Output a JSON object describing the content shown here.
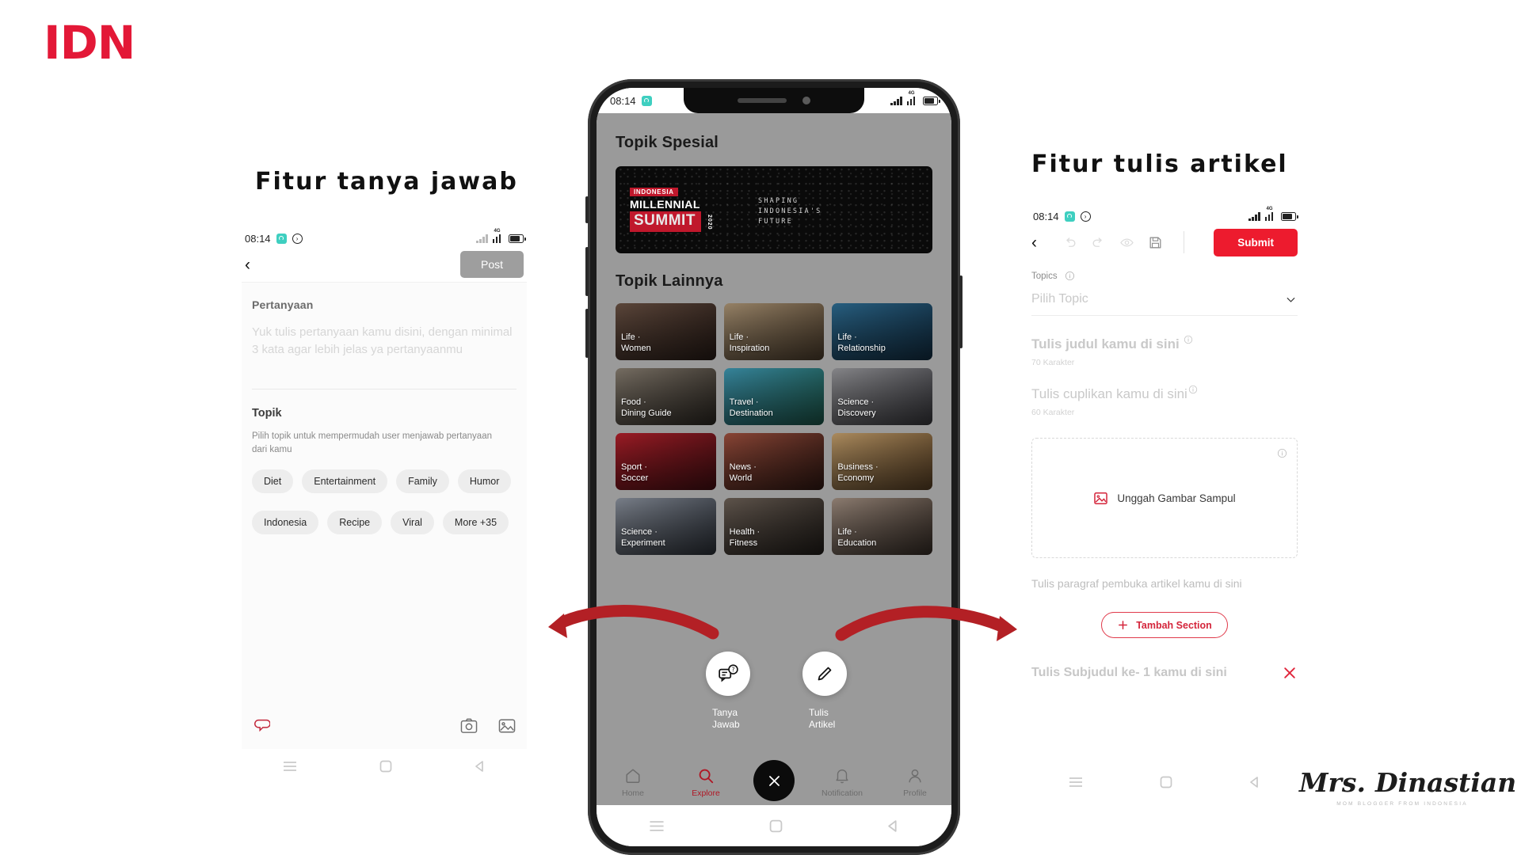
{
  "brand": {
    "logo_text": "IDN",
    "logo_color": "#e31837"
  },
  "headings": {
    "left": "Fitur tanya jawab",
    "right": "Fitur tulis artikel"
  },
  "status_bar": {
    "time": "08:14",
    "network": "4G"
  },
  "left_panel": {
    "back_icon": "‹",
    "post_label": "Post",
    "question_label": "Pertanyaan",
    "question_placeholder": "Yuk tulis pertanyaan kamu disini, dengan minimal 3 kata agar lebih jelas ya pertanyaanmu",
    "topik_label": "Topik",
    "topik_desc": "Pilih topik untuk mempermudah user menjawab pertanyaan dari kamu",
    "chips_row1": [
      "Diet",
      "Entertainment",
      "Family",
      "Humor"
    ],
    "chips_row2": [
      "Indonesia",
      "Recipe",
      "Viral",
      "More +35"
    ],
    "bottom_icons": [
      "comment-icon",
      "camera-icon",
      "gallery-icon"
    ]
  },
  "phone": {
    "special_topic_title": "Topik Spesial",
    "banner": {
      "line1": "INDONESIA",
      "line2": "MILLENNIAL",
      "line3": "SUMMIT",
      "year": "2020",
      "tagline": "SHAPING\nINDONESIA'S\nFUTURE"
    },
    "other_topic_title": "Topik Lainnya",
    "tiles": [
      {
        "cat": "Life ·",
        "sub": "Women",
        "c1": "#6b5244",
        "c2": "#2a1d18"
      },
      {
        "cat": "Life ·",
        "sub": "Inspiration",
        "c1": "#b09878",
        "c2": "#51412f"
      },
      {
        "cat": "Life ·",
        "sub": "Relationship",
        "c1": "#2e6f96",
        "c2": "#133046"
      },
      {
        "cat": "Food ·",
        "sub": "Dining Guide",
        "c1": "#8a8073",
        "c2": "#2f2a24"
      },
      {
        "cat": "Travel ·",
        "sub": "Destination",
        "c1": "#3f9ab5",
        "c2": "#1d5a4c"
      },
      {
        "cat": "Science ·",
        "sub": "Discovery",
        "c1": "#9c9ca0",
        "c2": "#3b3b40"
      },
      {
        "cat": "Sport ·",
        "sub": "Soccer",
        "c1": "#b6202b",
        "c2": "#4a1014"
      },
      {
        "cat": "News ·",
        "sub": "World",
        "c1": "#a1513f",
        "c2": "#351a14"
      },
      {
        "cat": "Business ·",
        "sub": "Economy",
        "c1": "#c9a36e",
        "c2": "#5e4427"
      },
      {
        "cat": "Science ·",
        "sub": "Experiment",
        "c1": "#8d94a0",
        "c2": "#2f343c"
      },
      {
        "cat": "Health ·",
        "sub": "Fitness",
        "c1": "#6e6258",
        "c2": "#241f1b"
      },
      {
        "cat": "Life ·",
        "sub": "Education",
        "c1": "#a49183",
        "c2": "#3a3029"
      }
    ],
    "fab_tanya": {
      "icon": "question-chat-icon",
      "label": "Tanya\nJawab"
    },
    "fab_tulis": {
      "icon": "pencil-icon",
      "label": "Tulis\nArtikel"
    },
    "nav": [
      {
        "label": "Home",
        "icon": "home-icon",
        "active": false
      },
      {
        "label": "Explore",
        "icon": "search-icon",
        "active": true
      },
      {
        "label": "",
        "icon": "close-icon",
        "active": false
      },
      {
        "label": "Notification",
        "icon": "bell-icon",
        "active": false
      },
      {
        "label": "Profile",
        "icon": "person-icon",
        "active": false
      }
    ],
    "accent": "#b01725"
  },
  "right_panel": {
    "back_icon": "‹",
    "tools": [
      "undo-icon",
      "redo-icon",
      "preview-eye-icon",
      "save-disk-icon"
    ],
    "submit_label": "Submit",
    "topics_label": "Topics",
    "topic_select_value": "Pilih Topic",
    "title_placeholder": "Tulis judul kamu di sini",
    "title_char_note": "70 Karakter",
    "excerpt_placeholder": "Tulis cuplikan kamu di sini",
    "excerpt_char_note": "60 Karakter",
    "upload_label": "Unggah Gambar Sampul",
    "paragraph_placeholder": "Tulis paragraf pembuka artikel kamu di sini",
    "add_section_label": "Tambah Section",
    "subtitle_placeholder": "Tulis Subjudul ke- 1  kamu di sini",
    "accent": "#ed1b2e"
  },
  "watermark": {
    "name_part1": "Mrs.",
    "name_part2": "Dinastian",
    "tagline": "MOM BLOGGER FROM INDONESIA"
  },
  "arrows": {
    "color": "#b32025",
    "count": 2
  }
}
